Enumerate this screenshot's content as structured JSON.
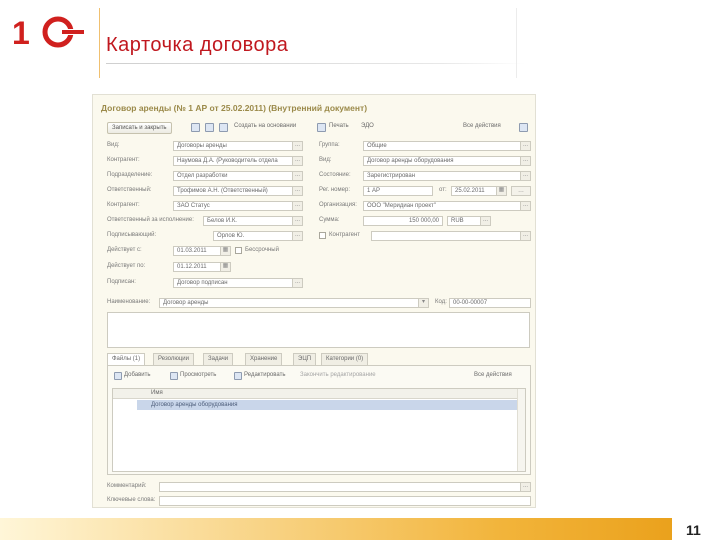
{
  "slide": {
    "title": "Карточка договора",
    "page_number": "11",
    "logo_text": "1С"
  },
  "form": {
    "title": "Договор аренды (№ 1 АР от 25.02.2011) (Внутренний документ)",
    "toolbar": {
      "save_close": "Записать и закрыть",
      "create_based": "Создать на основании",
      "print": "Печать",
      "edo": "ЭДО",
      "all_actions": "Все действия",
      "help": "?"
    },
    "fields": {
      "type_label": "Вид:",
      "type_value": "Договоры аренды",
      "group_label": "Группа:",
      "group_value": "Общие",
      "correspondent_label": "Контрагент:",
      "correspondent_value": "Наумова Д.А. (Руководитель отдела",
      "vid_label": "Вид:",
      "vid_value": "Договор аренды оборудования",
      "department_label": "Подразделение:",
      "department_value": "Отдел разработки",
      "state_label": "Состояние:",
      "state_value": "Зарегистрирован",
      "responsible_label": "Ответственный:",
      "responsible_value": "Трофимов А.Н. (Ответственный)",
      "number_label": "Рег. номер:",
      "number_value": "1 АР",
      "date_label": "от:",
      "date_value": "25.02.2011",
      "org_label": "Контрагент:",
      "org_value": "ЗАО Статус",
      "organization_label": "Организация:",
      "organization_value": "ООО \"Меридиан проект\"",
      "project_label": "Ответственный за исполнение:",
      "project_value": "Белов И.К.",
      "sum_label": "Сумма:",
      "sum_value": "150 000,00",
      "currency_value": "RUB",
      "signer_label": "Подписывающий:",
      "signer_value": "Орлов Ю.",
      "contract_label": "Контрагент",
      "valid_from_label": "Действует с:",
      "valid_from_value": "01.03.2011",
      "indefinite_label": "Бессрочный",
      "valid_to_label": "Действует по:",
      "valid_to_value": "01.12.2011",
      "sign_label": "Подписан:",
      "sign_value": "Договор подписан",
      "name_label": "Наименование:",
      "name_value": "Договор аренды",
      "code_label": "Код:",
      "code_value": "00-00-00007",
      "comment_label": "Комментарий:",
      "keywords_label": "Ключевые слова:"
    },
    "tabs": [
      "Файлы (1)",
      "Резолюции",
      "Задачи",
      "Хранение",
      "ЭЦП",
      "Категории (0)"
    ],
    "panel_toolbar": {
      "add": "Добавить",
      "view": "Просмотреть",
      "edit": "Редактировать",
      "finish_edit": "Закончить редактирование",
      "all_actions": "Все действия"
    },
    "grid": {
      "header": "Имя",
      "rows": [
        "Договор аренды оборудования"
      ]
    }
  }
}
